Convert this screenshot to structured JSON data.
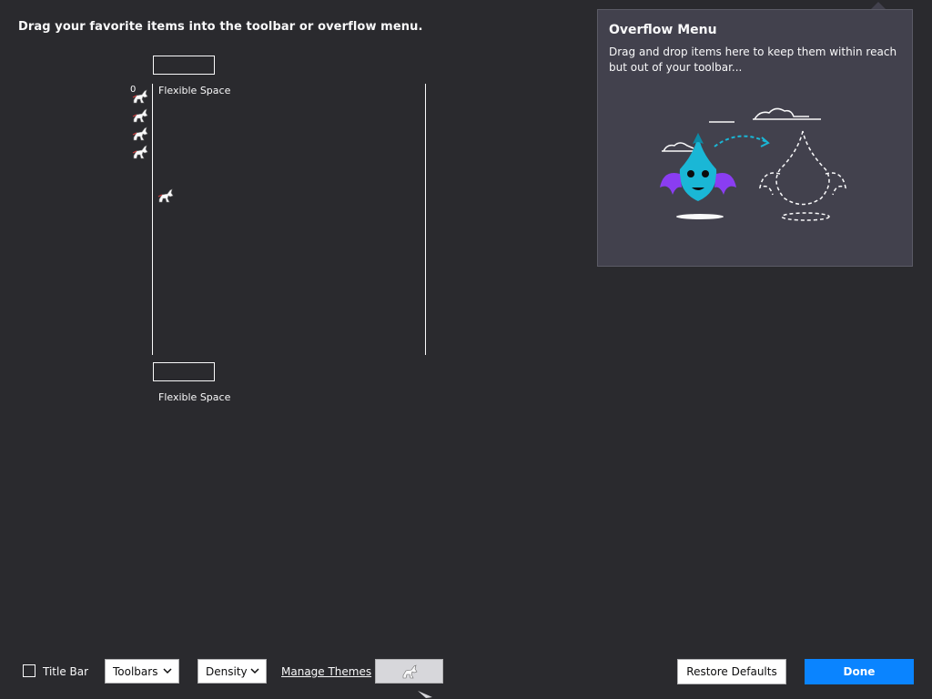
{
  "header": {
    "instructions": "Drag your favorite items into the toolbar or overflow menu."
  },
  "palette": {
    "top_item_label": "Flexible Space",
    "bottom_item_label": "Flexible Space",
    "tiny_glyph": "0",
    "icons": [
      "unicorn-icon",
      "unicorn-icon",
      "unicorn-icon",
      "unicorn-icon",
      "unicorn-icon"
    ]
  },
  "overflow": {
    "title": "Overflow Menu",
    "description": "Drag and drop items here to keep them within reach but out of your toolbar...",
    "illustration_icon": "dragon-illustration",
    "colors": {
      "panel_bg": "#42414d",
      "dragon": "#1ab7d6",
      "wings": "#8a3df2",
      "dashed_line": "#1ab7d6"
    }
  },
  "footer": {
    "titlebar_label": "Title Bar",
    "toolbars_label": "Toolbars",
    "density_label": "Density",
    "manage_themes_label": "Manage Themes",
    "restore_defaults_label": "Restore Defaults",
    "done_label": "Done"
  },
  "colors": {
    "background": "#2a2a2e",
    "accent": "#0a84ff",
    "text": "#f9f9fa"
  }
}
